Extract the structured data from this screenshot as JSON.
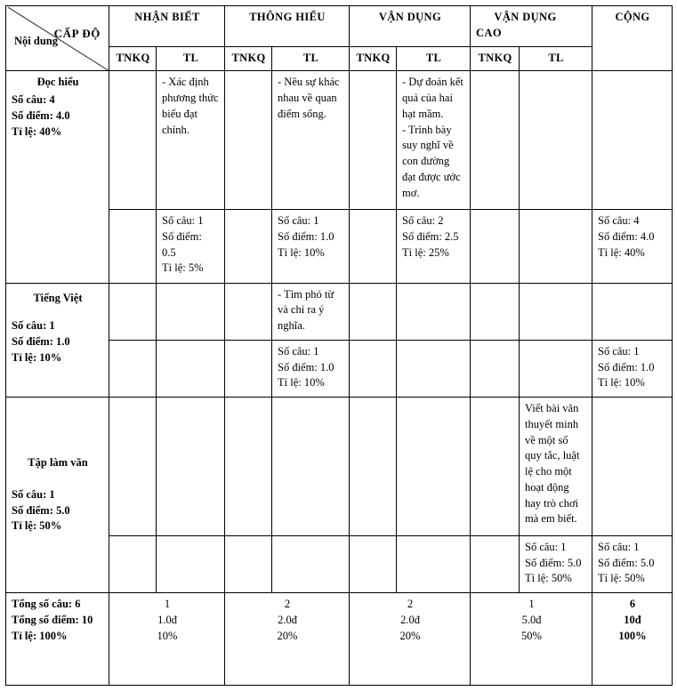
{
  "document": {
    "kind": "assessment-matrix-table",
    "language": "vi"
  },
  "header": {
    "corner": {
      "level_label": "CẤP ĐỘ",
      "content_label": "Nội dung",
      "diagonal": "top-left-to-bottom-right"
    },
    "levels": [
      {
        "key": "nhan_biet",
        "label": "NHẬN BIẾT"
      },
      {
        "key": "thong_hieu",
        "label": "THÔNG HIỂU"
      },
      {
        "key": "van_dung",
        "label": "VẬN DỤNG"
      },
      {
        "key": "van_dung_cao",
        "label_line1": "VẬN DỤNG",
        "label_line2": "CAO"
      }
    ],
    "total_label": "CỘNG",
    "sub_columns": [
      {
        "tnkq": "TNKQ",
        "tl": "TL"
      },
      {
        "tnkq": "TNKQ",
        "tl": "TL"
      },
      {
        "tnkq": "TNKQ",
        "tl": "TL"
      },
      {
        "tnkq": "TNKQ",
        "tl": "TL"
      }
    ]
  },
  "rows": [
    {
      "key": "doc_hieu",
      "label": {
        "title": "Đọc hiểu",
        "so_cau": "Số câu: 4",
        "so_diem": "Số điểm: 4.0",
        "ti_le": "Tỉ lệ: 40%"
      },
      "content": {
        "nb_tnkq": "",
        "nb_tl": "- Xác định phương thức biểu đạt chính.",
        "th_tnkq": "",
        "th_tl": "- Nêu sự khác nhau về quan điểm sống.",
        "vd_tnkq": "",
        "vd_tl_line1": "- Dự đoán kết quả của hai hạt mầm.",
        "vd_tl_line2": "- Trình bày suy nghĩ về con đường đạt được ước mơ.",
        "vdc_tnkq": "",
        "vdc_tl": "",
        "cong": ""
      },
      "summary": {
        "nb_tnkq": {
          "so_cau": "",
          "so_diem": "",
          "ti_le": ""
        },
        "nb_tl": {
          "so_cau": "Số câu: 1",
          "so_diem": "Số điểm:",
          "so_diem_value": "0.5",
          "ti_le": "Tỉ lệ: 5%"
        },
        "th_tnkq": {
          "so_cau": "",
          "so_diem": "",
          "ti_le": ""
        },
        "th_tl": {
          "so_cau": "Số câu: 1",
          "so_diem": "Số điểm: 1.0",
          "ti_le": "Tỉ lệ: 10%"
        },
        "vd_tnkq": {
          "so_cau": "",
          "so_diem": "",
          "ti_le": ""
        },
        "vd_tl": {
          "so_cau": "Số câu: 2",
          "so_diem": "Số điểm: 2.5",
          "ti_le": "Tỉ lệ: 25%"
        },
        "vdc_tnkq": {
          "so_cau": "",
          "so_diem": "",
          "ti_le": ""
        },
        "vdc_tl": {
          "so_cau": "",
          "so_diem": "",
          "ti_le": ""
        },
        "cong": {
          "so_cau": "Số câu: 4",
          "so_diem": "Số điểm: 4.0",
          "ti_le": "Tỉ lệ: 40%"
        }
      }
    },
    {
      "key": "tieng_viet",
      "label": {
        "title": "Tiếng Việt",
        "so_cau": "Số câu: 1",
        "so_diem": "Số điểm: 1.0",
        "ti_le": "Tỉ lệ: 10%"
      },
      "content": {
        "nb_tnkq": "",
        "nb_tl": "",
        "th_tnkq": "",
        "th_tl": "- Tìm phó từ và chỉ ra ý nghĩa.",
        "vd_tnkq": "",
        "vd_tl": "",
        "vdc_tnkq": "",
        "vdc_tl": "",
        "cong": ""
      },
      "summary": {
        "nb_tnkq": {
          "so_cau": "",
          "so_diem": "",
          "ti_le": ""
        },
        "nb_tl": {
          "so_cau": "",
          "so_diem": "",
          "ti_le": ""
        },
        "th_tnkq": {
          "so_cau": "",
          "so_diem": "",
          "ti_le": ""
        },
        "th_tl": {
          "so_cau": "Số câu: 1",
          "so_diem": "Số điểm: 1.0",
          "ti_le": "Tỉ lệ: 10%"
        },
        "vd_tnkq": {
          "so_cau": "",
          "so_diem": "",
          "ti_le": ""
        },
        "vd_tl": {
          "so_cau": "",
          "so_diem": "",
          "ti_le": ""
        },
        "vdc_tnkq": {
          "so_cau": "",
          "so_diem": "",
          "ti_le": ""
        },
        "vdc_tl": {
          "so_cau": "",
          "so_diem": "",
          "ti_le": ""
        },
        "cong": {
          "so_cau": "Số câu: 1",
          "so_diem": "Số điểm: 1.0",
          "ti_le": "Tỉ lệ: 10%"
        }
      }
    },
    {
      "key": "tap_lam_van",
      "label": {
        "title": "Tập làm văn",
        "so_cau": "Số câu: 1",
        "so_diem": "Số điểm: 5.0",
        "ti_le": "Tỉ lệ: 50%"
      },
      "content": {
        "nb_tnkq": "",
        "nb_tl": "",
        "th_tnkq": "",
        "th_tl": "",
        "vd_tnkq": "",
        "vd_tl": "",
        "vdc_tnkq": "",
        "vdc_tl": "Viết bài văn thuyết minh về một số quy tắc, luật lệ cho một hoạt động hay trò chơi mà em biết.",
        "cong": ""
      },
      "summary": {
        "nb_tnkq": {
          "so_cau": "",
          "so_diem": "",
          "ti_le": ""
        },
        "nb_tl": {
          "so_cau": "",
          "so_diem": "",
          "ti_le": ""
        },
        "th_tnkq": {
          "so_cau": "",
          "so_diem": "",
          "ti_le": ""
        },
        "th_tl": {
          "so_cau": "",
          "so_diem": "",
          "ti_le": ""
        },
        "vd_tnkq": {
          "so_cau": "",
          "so_diem": "",
          "ti_le": ""
        },
        "vd_tl": {
          "so_cau": "",
          "so_diem": "",
          "ti_le": ""
        },
        "vdc_tnkq": {
          "so_cau": "",
          "so_diem": "",
          "ti_le": ""
        },
        "vdc_tl": {
          "so_cau": "Số câu: 1",
          "so_diem": "Số điểm: 5.0",
          "ti_le": "Tỉ lệ: 50%"
        },
        "cong": {
          "so_cau": "Số câu: 1",
          "so_diem": "Số điểm: 5.0",
          "ti_le": "Tỉ lệ: 50%"
        }
      }
    }
  ],
  "totals": {
    "label": {
      "tong_so_cau": "Tổng số câu: 6",
      "tong_so_diem": "Tổng số điểm: 10",
      "ti_le": "Tỉ lệ: 100%"
    },
    "columns": [
      {
        "key": "nhan_biet",
        "so_cau": "1",
        "so_diem": "1.0đ",
        "ti_le": "10%",
        "bold": false
      },
      {
        "key": "thong_hieu",
        "so_cau": "2",
        "so_diem": "2.0đ",
        "ti_le": "20%",
        "bold": false
      },
      {
        "key": "van_dung",
        "so_cau": "2",
        "so_diem": "2.0đ",
        "ti_le": "20%",
        "bold": false
      },
      {
        "key": "van_dung_cao",
        "so_cau": "1",
        "so_diem": "5.0đ",
        "ti_le": "50%",
        "bold": false
      },
      {
        "key": "cong",
        "so_cau": "6",
        "so_diem": "10đ",
        "ti_le": "100%",
        "bold": true
      }
    ]
  }
}
